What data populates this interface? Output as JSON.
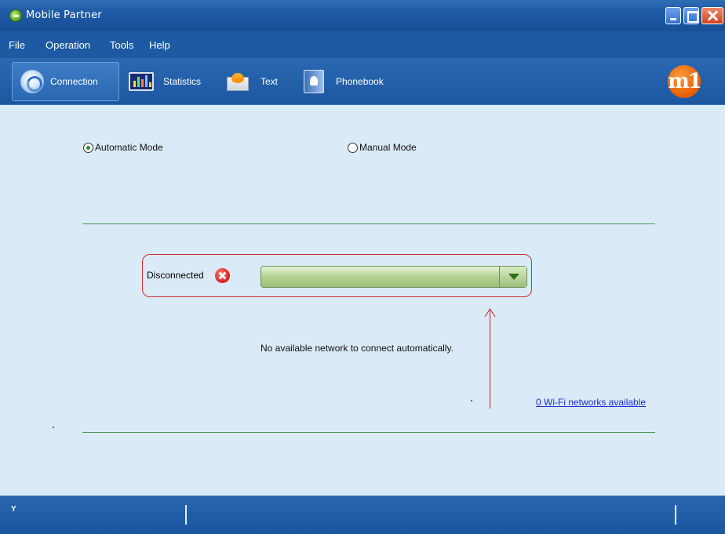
{
  "window": {
    "title": "Mobile Partner"
  },
  "menu": {
    "items": [
      {
        "label": "File"
      },
      {
        "label": "Operation"
      },
      {
        "label": "Tools"
      },
      {
        "label": "Help"
      }
    ]
  },
  "toolbar": {
    "items": [
      {
        "label": "Connection",
        "icon": "connection-icon",
        "active": true
      },
      {
        "label": "Statistics",
        "icon": "statistics-icon"
      },
      {
        "label": "Text",
        "icon": "text-message-icon"
      },
      {
        "label": "Phonebook",
        "icon": "phonebook-icon"
      }
    ],
    "brand_logo_text": "m1"
  },
  "connection": {
    "modes": [
      {
        "label": "Automatic Mode",
        "selected": true
      },
      {
        "label": "Manual Mode",
        "selected": false
      }
    ],
    "status_label": "Disconnected",
    "network_select_value": "",
    "message": "No available network to connect automatically.",
    "wifi_link": "0 Wi-Fi networks available"
  },
  "statusbar": {
    "signal_glyph": "Y"
  },
  "colors": {
    "titlebar": "#1f5aa5",
    "content_bg": "#dbeaf7",
    "divider": "#4c9a55",
    "highlight_red": "#d22b2b",
    "link": "#1a2fd0"
  }
}
